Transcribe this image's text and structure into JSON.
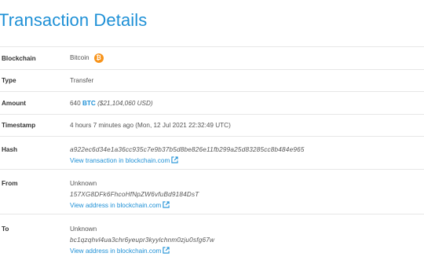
{
  "page": {
    "title": "Transaction Details"
  },
  "details": {
    "blockchain": {
      "label": "Blockchain",
      "value": "Bitcoin",
      "icon": "bitcoin-icon",
      "icon_glyph": "₿",
      "icon_color": "#f7931a"
    },
    "type": {
      "label": "Type",
      "value": "Transfer"
    },
    "amount": {
      "label": "Amount",
      "value": "640",
      "currency": "BTC",
      "usd": "($21,104,060 USD)"
    },
    "timestamp": {
      "label": "Timestamp",
      "value": "4 hours 7 minutes ago (Mon, 12 Jul 2021 22:32:49 UTC)"
    },
    "hash": {
      "label": "Hash",
      "value": "a922ec6d34e1a36cc935c7e9b37b5d8be826e11fb299a25d83285cc8b484e965",
      "link": "View transaction in blockchain.com"
    },
    "from": {
      "label": "From",
      "name": "Unknown",
      "address": "157XG8DFk6FhcoHfNpZW6vfuBd9184DsT",
      "link": "View address in blockchain.com"
    },
    "to": {
      "label": "To",
      "name": "Unknown",
      "address": "bc1qzqhvl4ua3chr6yeupr3kyylchnm0zju0sfg67w",
      "link": "View address in blockchain.com"
    }
  },
  "colors": {
    "accent": "#1e90d6",
    "bitcoin": "#f7931a",
    "border": "#e6e6e6"
  }
}
